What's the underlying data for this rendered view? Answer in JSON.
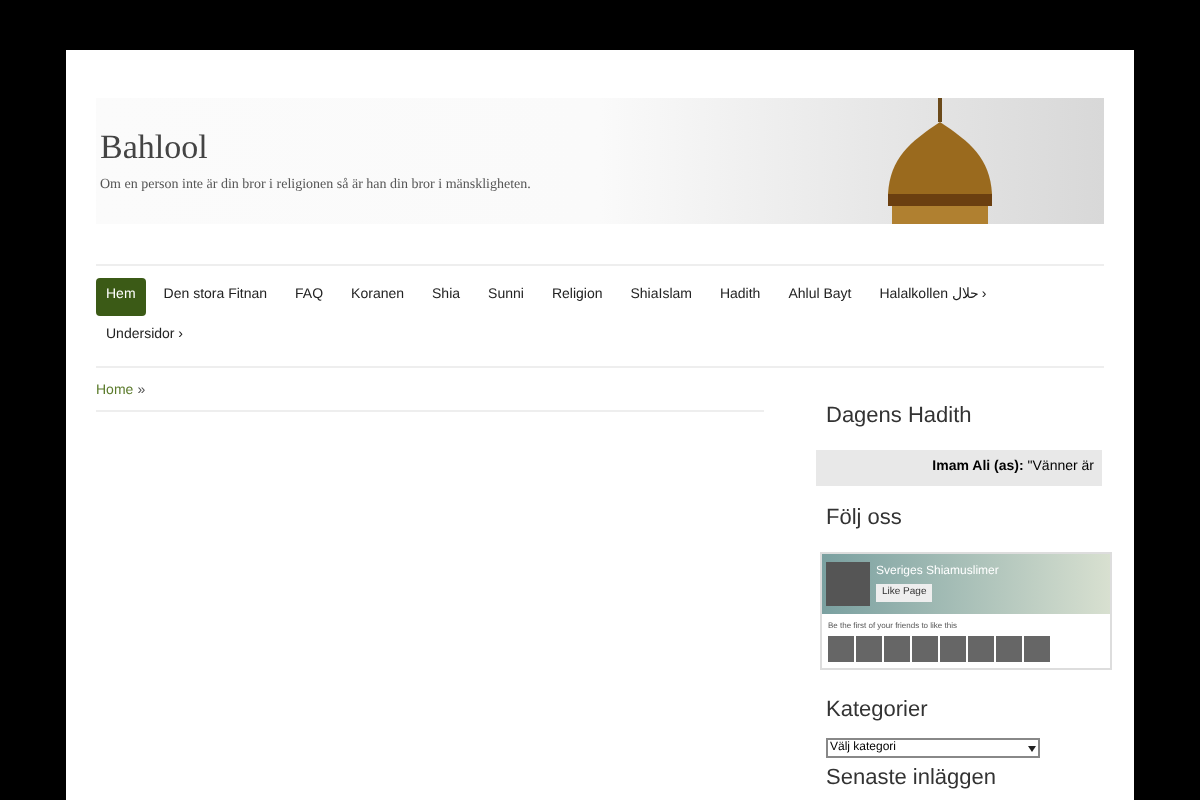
{
  "site": {
    "title": "Bahlool",
    "tagline": "Om en person inte är din bror i religionen så är han din bror i mänskligheten."
  },
  "nav": [
    {
      "label": "Hem",
      "selected": true
    },
    {
      "label": "Den stora Fitnan",
      "selected": false
    },
    {
      "label": "FAQ",
      "selected": false
    },
    {
      "label": "Koranen",
      "selected": false
    },
    {
      "label": "Shia",
      "selected": false
    },
    {
      "label": "Sunni",
      "selected": false
    },
    {
      "label": "Religion",
      "selected": false
    },
    {
      "label": "ShiaIslam",
      "selected": false
    },
    {
      "label": "Hadith",
      "selected": false
    },
    {
      "label": "Ahlul Bayt",
      "selected": false
    },
    {
      "label": "Halalkollen حلال ›",
      "selected": false
    },
    {
      "label": "Undersidor ›",
      "selected": false
    }
  ],
  "breadcrumb": {
    "link": "Home",
    "separator": "»"
  },
  "sidebar": {
    "hadith": {
      "title": "Dagens Hadith",
      "author": "Imam Ali (as):",
      "quote": "\"Vänner är"
    },
    "follow": {
      "title": "Följ oss",
      "page_name": "Sveriges Shiamuslimer",
      "like_button": "Like Page",
      "friends_text": "Be the first of your friends to like this"
    },
    "categories": {
      "title": "Kategorier",
      "select_value": "Välj kategori"
    },
    "recent": {
      "title": "Senaste inläggen"
    }
  }
}
